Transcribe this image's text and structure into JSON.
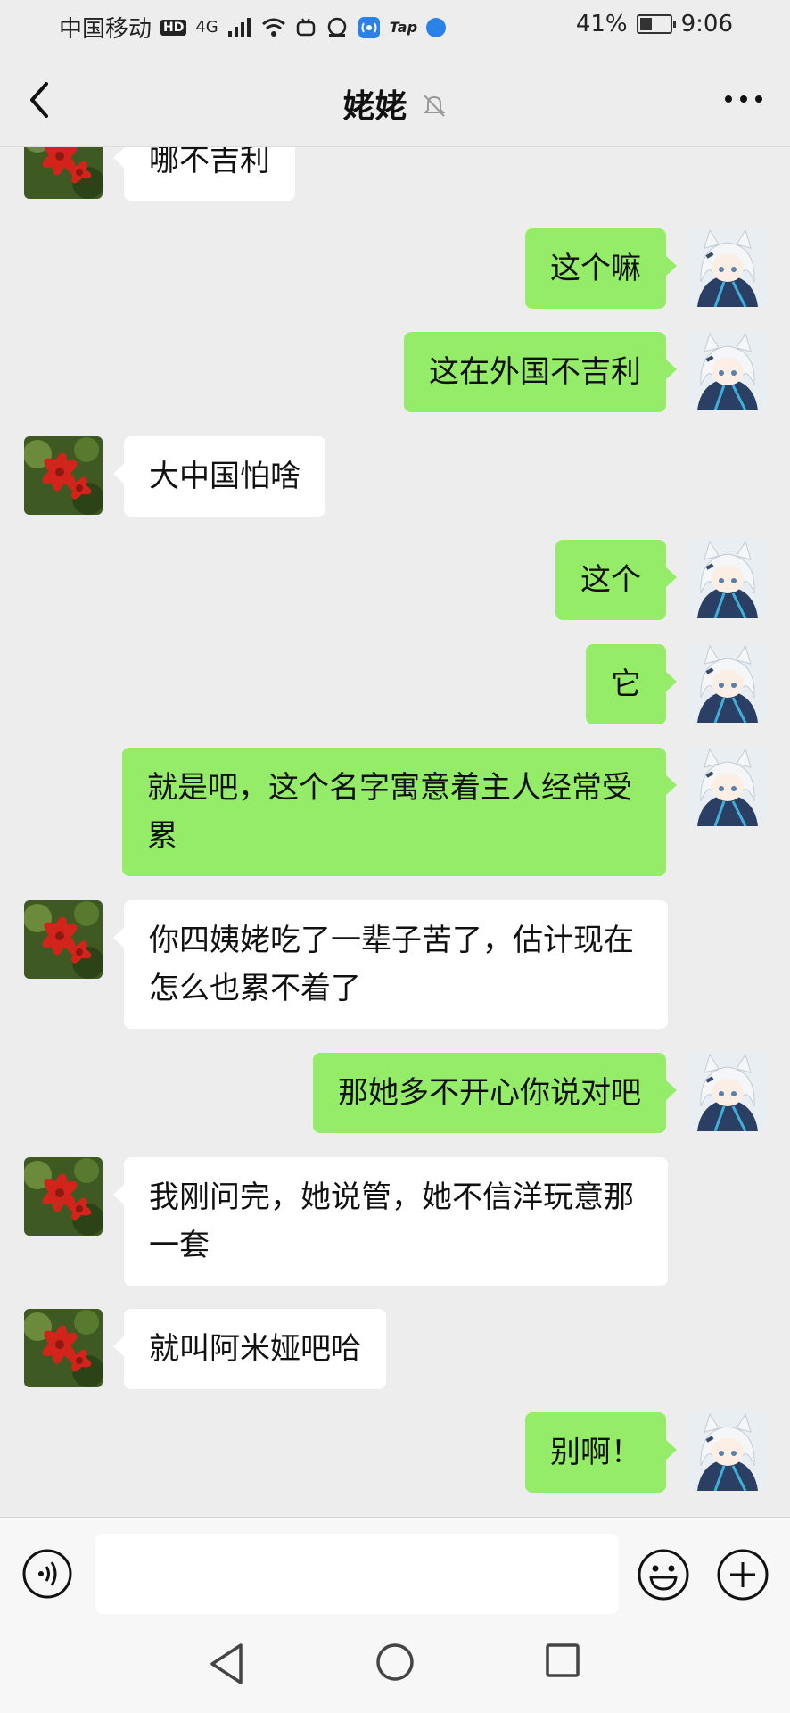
{
  "status_bar": {
    "carrier": "中国移动",
    "hd": "HD",
    "network": "4G",
    "tap": "Tap",
    "battery_percent": "41%",
    "battery_level": 0.41,
    "time": "9:06"
  },
  "header": {
    "title": "姥姥",
    "icons": {
      "back": "chevron-left-icon",
      "muted": "bell-muted-icon",
      "more": "more-dots-icon"
    }
  },
  "colors": {
    "sent_bubble": "#95ec69",
    "received_bubble": "#ffffff",
    "background": "#ededed"
  },
  "messages": [
    {
      "side": "left",
      "text": "哪不吉利"
    },
    {
      "side": "right",
      "text": "这个嘛"
    },
    {
      "side": "right",
      "text": "这在外国不吉利"
    },
    {
      "side": "left",
      "text": "大中国怕啥"
    },
    {
      "side": "right",
      "text": "这个"
    },
    {
      "side": "right",
      "text": "它"
    },
    {
      "side": "right",
      "text": "就是吧，这个名字寓意着主人经常受累"
    },
    {
      "side": "left",
      "text": "你四姨姥吃了一辈子苦了，估计现在怎么也累不着了"
    },
    {
      "side": "right",
      "text": "那她多不开心你说对吧"
    },
    {
      "side": "left",
      "text": "我刚问完，她说管，她不信洋玩意那一套"
    },
    {
      "side": "left",
      "text": "就叫阿米娅吧哈"
    },
    {
      "side": "right",
      "text": "别啊！"
    }
  ],
  "input_bar": {
    "placeholder": "",
    "icons": {
      "voice": "voice-icon",
      "emoji": "emoji-icon",
      "more": "plus-icon"
    }
  },
  "nav_bar": {
    "icons": [
      "nav-back-icon",
      "nav-home-icon",
      "nav-recent-icon"
    ]
  }
}
